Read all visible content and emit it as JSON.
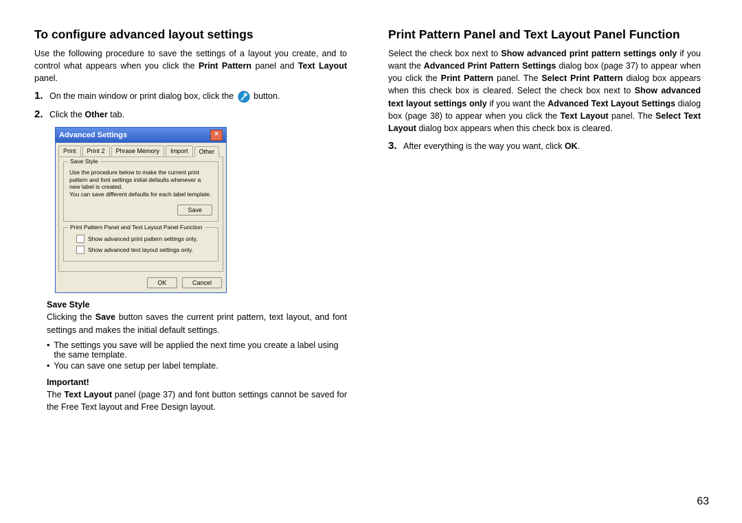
{
  "left": {
    "heading": "To configure advanced layout settings",
    "intro_1": "Use the following procedure to save the settings of a layout you create, and to control what appears when you click the ",
    "intro_bold1": "Print Pattern",
    "intro_2": " panel and ",
    "intro_bold2": "Text Layout",
    "intro_3": " panel.",
    "step1_a": "On the main window or print dialog box, click the ",
    "step1_b": " button.",
    "step2_a": "Click the ",
    "step2_bold": "Other",
    "step2_b": " tab.",
    "save_style_head": "Save Style",
    "save_style_1a": "Clicking the ",
    "save_style_1bold": "Save",
    "save_style_1b": " button saves the current print pattern, text layout, and font settings and makes the initial default settings.",
    "bullet1": "The settings you save will be applied the next time you create a label using the same template.",
    "bullet2": "You can save one setup per label template.",
    "important_head": "Important!",
    "important_1a": "The ",
    "important_bold": "Text Layout",
    "important_1b": " panel (page 37) and font button settings cannot be saved for the Free Text layout and Free Design layout."
  },
  "dialog": {
    "title": "Advanced Settings",
    "tabs": [
      "Print",
      "Print 2",
      "Phrase Memory",
      "Import",
      "Other"
    ],
    "fs1_legend": "Save Style",
    "fs1_body": "Use the procedure below to make the current print pattern and font settings initial defaults whenever a new label is created.\nYou can save different defaults for each label template.",
    "btn_save": "Save",
    "fs2_legend": "Print Pattern Panel and Text Layout Panel Function",
    "chk1": "Show advanced print pattern settings only.",
    "chk2": "Show advanced text layout settings only.",
    "btn_ok": "OK",
    "btn_cancel": "Cancel"
  },
  "right": {
    "heading": "Print Pattern Panel and Text Layout Panel Function",
    "p_a": "Select the check box next to ",
    "p_b1": "Show advanced print pattern settings only",
    "p_c": " if you want the ",
    "p_b2": "Advanced Print Pattern Settings",
    "p_d": " dialog box (page 37) to appear when you click the ",
    "p_b3": "Print Pattern",
    "p_e": " panel. The ",
    "p_b4": "Select Print Pattern",
    "p_f": " dialog box appears when this check box is cleared. Select the check box next to ",
    "p_b5": "Show advanced text layout settings only",
    "p_g": " if you want the ",
    "p_b6": "Advanced Text Layout Settings",
    "p_h": " dialog box (page 38) to appear when you click the ",
    "p_b7": "Text Layout",
    "p_i": " panel. The ",
    "p_b8": "Select Text Layout",
    "p_j": " dialog box appears when this check box is cleared.",
    "step3_a": "After everything is the way you want, click ",
    "step3_bold": "OK",
    "step3_b": "."
  },
  "pagenum": "63"
}
